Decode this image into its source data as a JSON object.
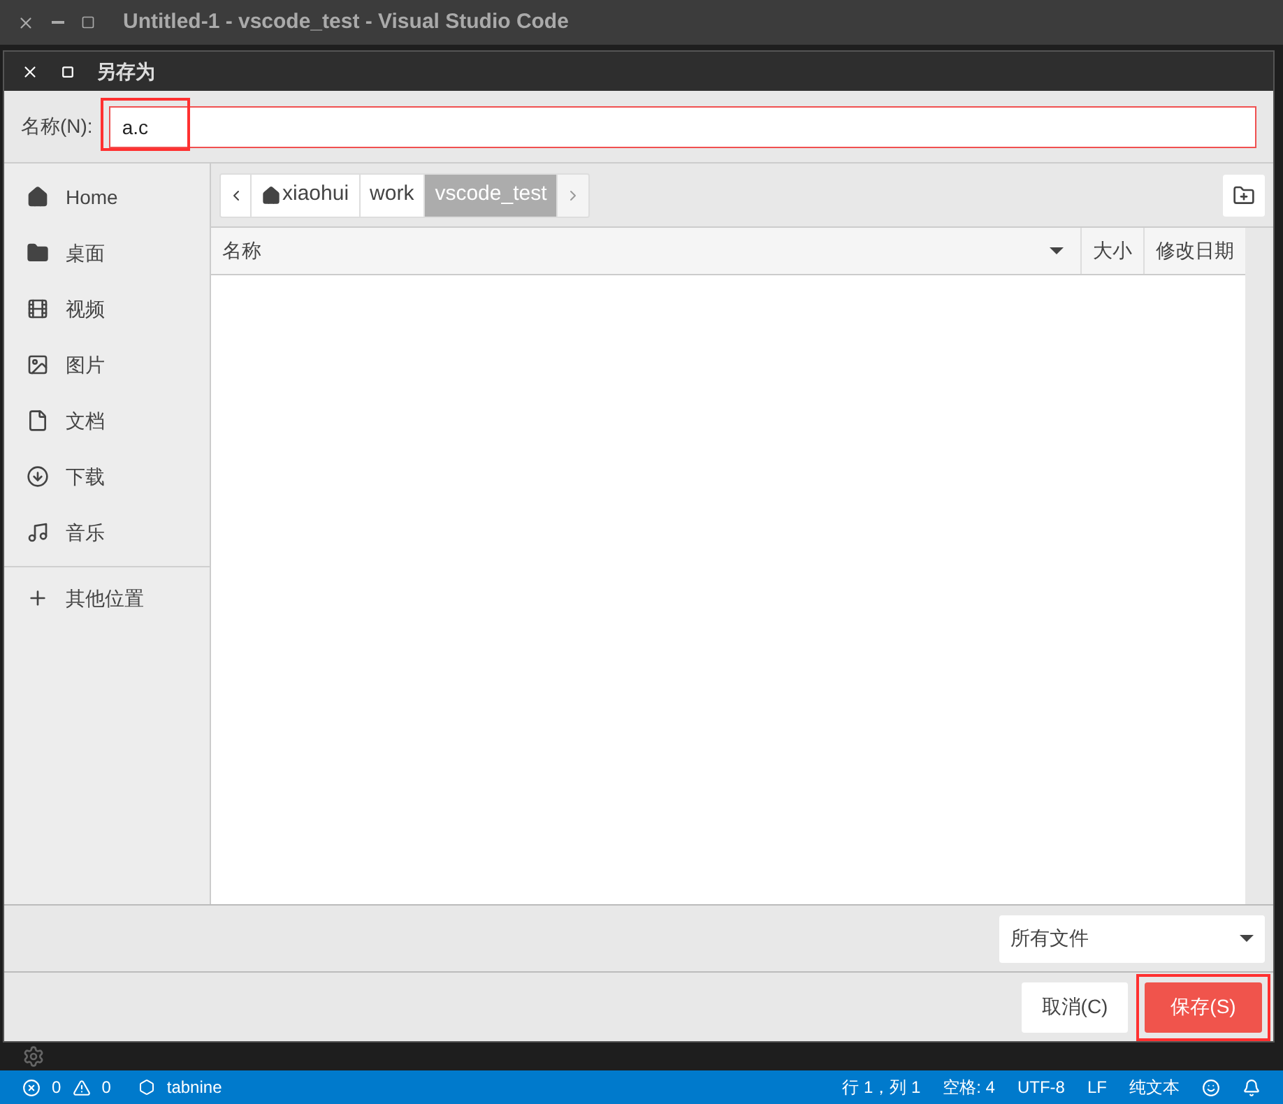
{
  "window": {
    "title": "Untitled-1 - vscode_test - Visual Studio Code"
  },
  "dialog": {
    "title": "另存为",
    "name_field": {
      "label": "名称(N):",
      "value": "a.c",
      "highlighted": true
    },
    "sidebar": {
      "items": [
        {
          "label": "Home",
          "selected": false
        },
        {
          "label": "桌面",
          "selected": false
        },
        {
          "label": "视频",
          "selected": false
        },
        {
          "label": "图片",
          "selected": false
        },
        {
          "label": "文档",
          "selected": false
        },
        {
          "label": "下载",
          "selected": false
        },
        {
          "label": "音乐",
          "selected": false
        }
      ],
      "other": {
        "label": "其他位置"
      }
    },
    "path_bar": [
      {
        "label": "xiaohui",
        "selected": false
      },
      {
        "label": "work",
        "selected": false
      },
      {
        "label": "vscode_test",
        "selected": true
      }
    ],
    "table": {
      "columns": [
        {
          "label": "名称",
          "sorted": true
        },
        {
          "label": "大小",
          "sorted": false
        },
        {
          "label": "修改日期",
          "sorted": false
        }
      ]
    },
    "filter": "所有文件",
    "buttons": [
      {
        "label": "取消(C)",
        "kind": "cancel",
        "highlighted": false
      },
      {
        "label": "保存(S)",
        "kind": "primary",
        "highlighted": true
      }
    ]
  },
  "status_bar": {
    "errors": "0",
    "warnings": "0",
    "tabnine": "tabnine",
    "right": [
      "行 1，列 1",
      "空格: 4",
      "UTF-8",
      "LF",
      "纯文本"
    ]
  }
}
